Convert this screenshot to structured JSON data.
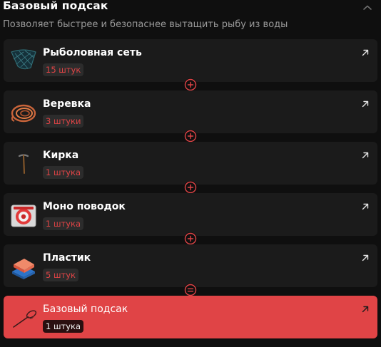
{
  "header": {
    "title": "Базовый подсак",
    "subtitle": "Позволяет быстрее и безопаснее вытащить рыбу из воды",
    "collapse_icon": "chevron-up-icon"
  },
  "colors": {
    "background": "#0f0f0f",
    "card": "#1b1b1b",
    "accent": "#e04446",
    "badge_bg": "#2c2c2c",
    "muted_text": "#9a9a9a"
  },
  "recipe": [
    {
      "name": "Рыболовная сеть",
      "quantity": "15 штук",
      "icon": "fishing-net-icon",
      "link_icon": "arrow-up-right-icon"
    },
    {
      "name": "Веревка",
      "quantity": "3 штуки",
      "icon": "rope-icon",
      "link_icon": "arrow-up-right-icon"
    },
    {
      "name": "Кирка",
      "quantity": "1 штука",
      "icon": "pickaxe-icon",
      "link_icon": "arrow-up-right-icon"
    },
    {
      "name": "Моно поводок",
      "quantity": "1 штука",
      "icon": "mono-leader-spool-icon",
      "link_icon": "arrow-up-right-icon"
    },
    {
      "name": "Пластик",
      "quantity": "5 штук",
      "icon": "plastic-icon",
      "link_icon": "arrow-up-right-icon"
    }
  ],
  "connectors": [
    "plus-icon",
    "plus-icon",
    "plus-icon",
    "plus-icon",
    "equals-icon"
  ],
  "result": {
    "name": "Базовый подсак",
    "quantity": "1 штука",
    "icon": "landing-net-icon",
    "link_icon": "arrow-up-right-icon"
  }
}
